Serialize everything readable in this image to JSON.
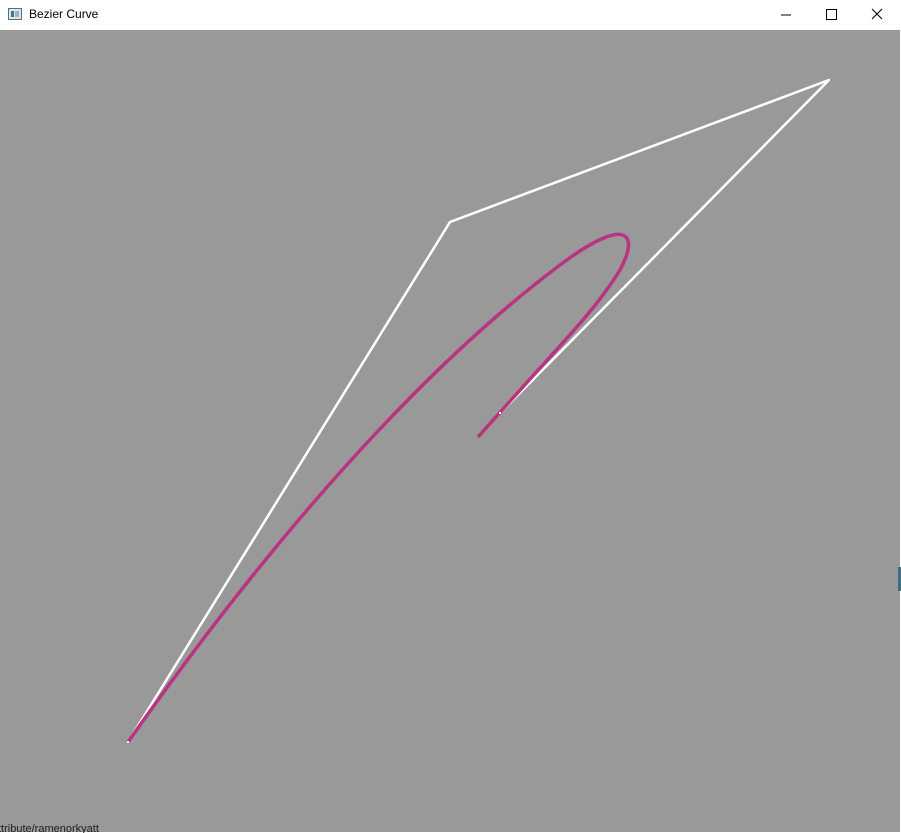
{
  "window": {
    "title": "Bezier Curve",
    "icon": "app-window-icon",
    "controls": {
      "minimize_icon": "minimize-icon",
      "maximize_icon": "maximize-icon",
      "close_icon": "close-icon"
    }
  },
  "canvas": {
    "background": "#999999",
    "control_polygon_color": "#ffffff",
    "curve_color": "#b8347e"
  },
  "footer": {
    "text": "ttribute/ramenorkyatt"
  }
}
